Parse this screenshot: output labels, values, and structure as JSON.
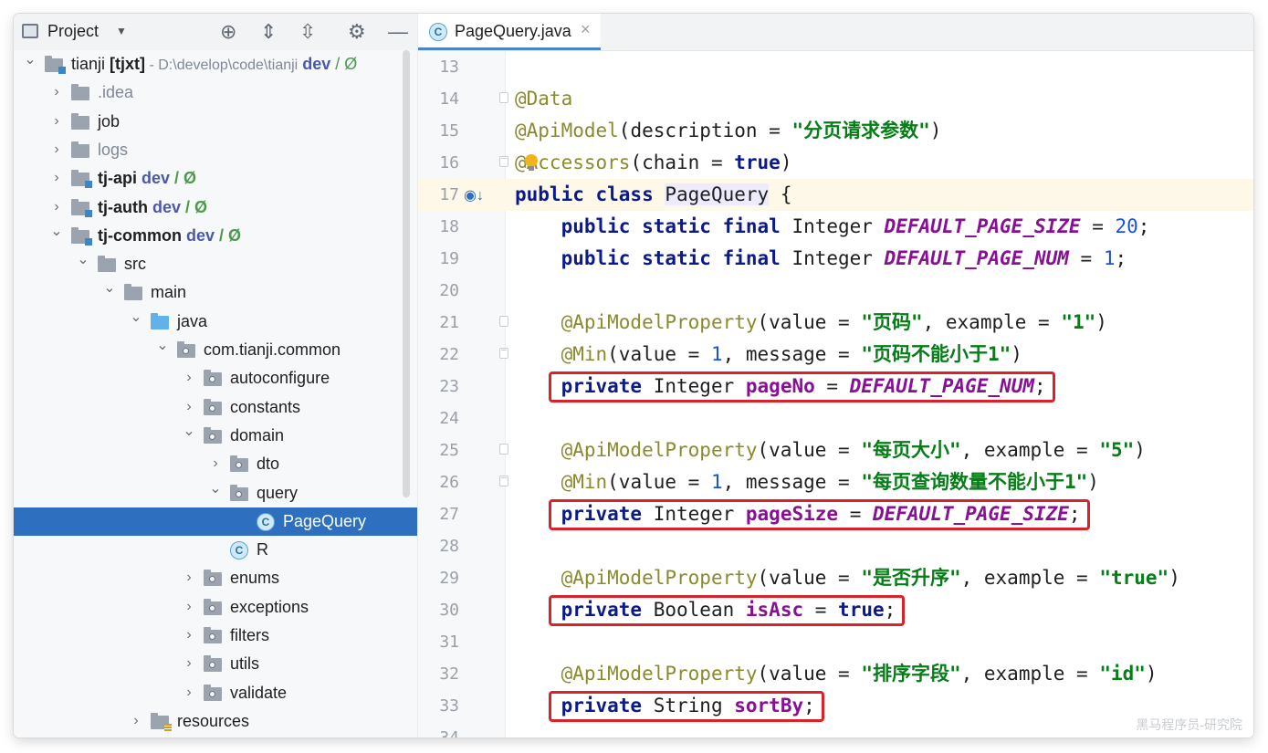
{
  "project_panel": {
    "title": "Project",
    "tree": [
      {
        "depth": 0,
        "label": "tianji",
        "suffix": " [tjxt]",
        "path": "  - D:\\develop\\code\\tianji",
        "vcs": "dev",
        "vcs_slash": " / Ø",
        "state": "expanded",
        "icon": "module"
      },
      {
        "depth": 1,
        "label": ".idea",
        "state": "collapsed",
        "icon": "folder",
        "grey": true
      },
      {
        "depth": 1,
        "label": "job",
        "state": "collapsed",
        "icon": "folder"
      },
      {
        "depth": 1,
        "label": "logs",
        "state": "collapsed",
        "icon": "folder",
        "grey": true
      },
      {
        "depth": 1,
        "label": "tj-api",
        "vcs": "dev",
        "vcs_slash": " / Ø",
        "state": "collapsed",
        "icon": "module",
        "bold": true
      },
      {
        "depth": 1,
        "label": "tj-auth",
        "vcs": "dev",
        "vcs_slash": " / Ø",
        "state": "collapsed",
        "icon": "module",
        "bold": true
      },
      {
        "depth": 1,
        "label": "tj-common",
        "vcs": "dev",
        "vcs_slash": " / Ø",
        "state": "expanded",
        "icon": "module",
        "bold": true
      },
      {
        "depth": 2,
        "label": "src",
        "state": "expanded",
        "icon": "folder"
      },
      {
        "depth": 3,
        "label": "main",
        "state": "expanded",
        "icon": "folder"
      },
      {
        "depth": 4,
        "label": "java",
        "state": "expanded",
        "icon": "source-folder"
      },
      {
        "depth": 5,
        "label": "com.tianji.common",
        "state": "expanded",
        "icon": "package"
      },
      {
        "depth": 6,
        "label": "autoconfigure",
        "state": "collapsed",
        "icon": "package"
      },
      {
        "depth": 6,
        "label": "constants",
        "state": "collapsed",
        "icon": "package"
      },
      {
        "depth": 6,
        "label": "domain",
        "state": "expanded",
        "icon": "package"
      },
      {
        "depth": 7,
        "label": "dto",
        "state": "collapsed",
        "icon": "package"
      },
      {
        "depth": 7,
        "label": "query",
        "state": "expanded",
        "icon": "package"
      },
      {
        "depth": 8,
        "label": "PageQuery",
        "state": "leaf",
        "icon": "class",
        "selected": true
      },
      {
        "depth": 7,
        "label": "R",
        "state": "leaf",
        "icon": "class"
      },
      {
        "depth": 6,
        "label": "enums",
        "state": "collapsed",
        "icon": "package"
      },
      {
        "depth": 6,
        "label": "exceptions",
        "state": "collapsed",
        "icon": "package"
      },
      {
        "depth": 6,
        "label": "filters",
        "state": "collapsed",
        "icon": "package"
      },
      {
        "depth": 6,
        "label": "utils",
        "state": "collapsed",
        "icon": "package"
      },
      {
        "depth": 6,
        "label": "validate",
        "state": "collapsed",
        "icon": "package"
      },
      {
        "depth": 4,
        "label": "resources",
        "state": "collapsed",
        "icon": "resources-folder"
      }
    ]
  },
  "editor": {
    "tab": {
      "label": "PageQuery.java",
      "icon_letter": "C"
    },
    "lines": [
      {
        "n": "13",
        "tokens": []
      },
      {
        "n": "14",
        "fold": "start",
        "tokens": [
          [
            "an",
            "@Data"
          ]
        ]
      },
      {
        "n": "15",
        "tokens": [
          [
            "an",
            "@ApiModel"
          ],
          [
            "",
            "(description = "
          ],
          [
            "st",
            "\"分页请求参数\""
          ],
          [
            "",
            ")"
          ]
        ]
      },
      {
        "n": "16",
        "fold": "end",
        "bulb": true,
        "tokens": [
          [
            "an",
            "@Accessors"
          ],
          [
            "",
            "(chain = "
          ],
          [
            "kw",
            "true"
          ],
          [
            "",
            ")"
          ]
        ]
      },
      {
        "n": "17",
        "current": true,
        "mark": true,
        "tokens": [
          [
            "kw",
            "public class "
          ],
          [
            "hl",
            "PageQuery"
          ],
          [
            "",
            " {"
          ]
        ]
      },
      {
        "n": "18",
        "tokens": [
          [
            "",
            "    "
          ],
          [
            "kw",
            "public static final "
          ],
          [
            "",
            "Integer "
          ],
          [
            "cn",
            "DEFAULT_PAGE_SIZE"
          ],
          [
            "",
            " = "
          ],
          [
            "nu",
            "20"
          ],
          [
            "",
            ";"
          ]
        ]
      },
      {
        "n": "19",
        "tokens": [
          [
            "",
            "    "
          ],
          [
            "kw",
            "public static final "
          ],
          [
            "",
            "Integer "
          ],
          [
            "cn",
            "DEFAULT_PAGE_NUM"
          ],
          [
            "",
            " = "
          ],
          [
            "nu",
            "1"
          ],
          [
            "",
            ";"
          ]
        ]
      },
      {
        "n": "20",
        "tokens": []
      },
      {
        "n": "21",
        "fold": "start",
        "tokens": [
          [
            "",
            "    "
          ],
          [
            "an",
            "@ApiModelProperty"
          ],
          [
            "",
            "(value = "
          ],
          [
            "st",
            "\"页码\""
          ],
          [
            "",
            ", example = "
          ],
          [
            "st",
            "\"1\""
          ],
          [
            "",
            ")"
          ]
        ]
      },
      {
        "n": "22",
        "fold": "end",
        "tokens": [
          [
            "",
            "    "
          ],
          [
            "an",
            "@Min"
          ],
          [
            "",
            "(value = "
          ],
          [
            "nu",
            "1"
          ],
          [
            "",
            ", message = "
          ],
          [
            "st",
            "\"页码不能小于1\""
          ],
          [
            "",
            ")"
          ]
        ]
      },
      {
        "n": "23",
        "tokens": [
          [
            "",
            "    "
          ],
          [
            "kw",
            "private "
          ],
          [
            "",
            "Integer "
          ],
          [
            "fd",
            "pageNo"
          ],
          [
            "",
            " = "
          ],
          [
            "cn",
            "DEFAULT_PAGE_NUM"
          ],
          [
            "",
            ";"
          ]
        ]
      },
      {
        "n": "24",
        "tokens": []
      },
      {
        "n": "25",
        "fold": "start",
        "tokens": [
          [
            "",
            "    "
          ],
          [
            "an",
            "@ApiModelProperty"
          ],
          [
            "",
            "(value = "
          ],
          [
            "st",
            "\"每页大小\""
          ],
          [
            "",
            ", example = "
          ],
          [
            "st",
            "\"5\""
          ],
          [
            "",
            ")"
          ]
        ]
      },
      {
        "n": "26",
        "fold": "end",
        "tokens": [
          [
            "",
            "    "
          ],
          [
            "an",
            "@Min"
          ],
          [
            "",
            "(value = "
          ],
          [
            "nu",
            "1"
          ],
          [
            "",
            ", message = "
          ],
          [
            "st",
            "\"每页查询数量不能小于1\""
          ],
          [
            "",
            ")"
          ]
        ]
      },
      {
        "n": "27",
        "tokens": [
          [
            "",
            "    "
          ],
          [
            "kw",
            "private "
          ],
          [
            "",
            "Integer "
          ],
          [
            "fd",
            "pageSize"
          ],
          [
            "",
            " = "
          ],
          [
            "cn",
            "DEFAULT_PAGE_SIZE"
          ],
          [
            "",
            ";"
          ]
        ]
      },
      {
        "n": "28",
        "tokens": []
      },
      {
        "n": "29",
        "tokens": [
          [
            "",
            "    "
          ],
          [
            "an",
            "@ApiModelProperty"
          ],
          [
            "",
            "(value = "
          ],
          [
            "st",
            "\"是否升序\""
          ],
          [
            "",
            ", example = "
          ],
          [
            "st",
            "\"true\""
          ],
          [
            "",
            ")"
          ]
        ]
      },
      {
        "n": "30",
        "tokens": [
          [
            "",
            "    "
          ],
          [
            "kw",
            "private "
          ],
          [
            "",
            "Boolean "
          ],
          [
            "fd",
            "isAsc"
          ],
          [
            "",
            " = "
          ],
          [
            "kw",
            "true"
          ],
          [
            "",
            ";"
          ]
        ]
      },
      {
        "n": "31",
        "tokens": []
      },
      {
        "n": "32",
        "tokens": [
          [
            "",
            "    "
          ],
          [
            "an",
            "@ApiModelProperty"
          ],
          [
            "",
            "(value = "
          ],
          [
            "st",
            "\"排序字段\""
          ],
          [
            "",
            ", example = "
          ],
          [
            "st",
            "\"id\""
          ],
          [
            "",
            ")"
          ]
        ]
      },
      {
        "n": "33",
        "tokens": [
          [
            "",
            "    "
          ],
          [
            "kw",
            "private "
          ],
          [
            "",
            "String "
          ],
          [
            "fd",
            "sortBy"
          ],
          [
            "",
            ";"
          ]
        ]
      },
      {
        "n": "34",
        "tokens": []
      }
    ],
    "highlighted_lines": [
      "23",
      "27",
      "30",
      "33"
    ]
  },
  "watermark": "黑马程序员-研究院",
  "colors": {
    "selection": "#2f6fbf",
    "highlight_box": "#d9232b",
    "keyword": "#0b1a8a",
    "string": "#067d17",
    "annotation": "#8a8a2e",
    "constant": "#871094"
  }
}
